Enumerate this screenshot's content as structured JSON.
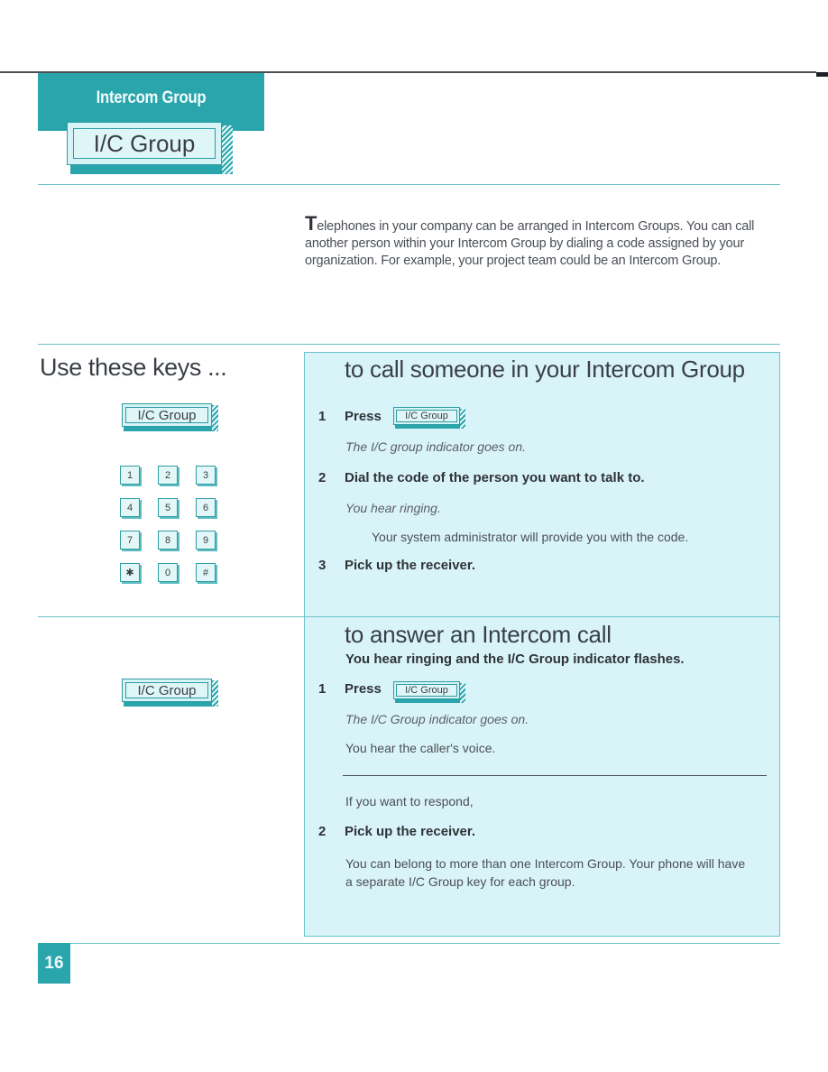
{
  "header": {
    "band_label": "Intercom Group",
    "key_label": "I/C Group"
  },
  "intro": {
    "drop_cap": "T",
    "text": "elephones in your company can be arranged in Intercom Groups. You can call another person within your Intercom Group by dialing a code assigned by your organization. For example, your project team could be an Intercom Group."
  },
  "left_column": {
    "heading": "Use these keys ...",
    "key_label": "I/C Group",
    "keypad": [
      "1",
      "2",
      "3",
      "4",
      "5",
      "6",
      "7",
      "8",
      "9",
      "✱",
      "0",
      "#"
    ],
    "answer_key_label": "I/C Group"
  },
  "call_section": {
    "title": "to call someone in your Intercom Group",
    "steps": [
      {
        "num": "1",
        "action": "Press",
        "key_label": "I/C Group",
        "result": "The I/C group indicator goes on."
      },
      {
        "num": "2",
        "action": "Dial the code of the person you want to talk to.",
        "result": "You hear ringing.",
        "note": "Your system administrator will provide you with the code."
      },
      {
        "num": "3",
        "action": "Pick up the receiver."
      }
    ]
  },
  "answer_section": {
    "title": "to answer an Intercom call",
    "subtitle": "You hear ringing and the I/C Group indicator flashes.",
    "steps": [
      {
        "num": "1",
        "action": "Press",
        "key_label": "I/C Group",
        "result": "The I/C Group indicator goes on.",
        "note": "You hear the caller's voice."
      },
      {
        "num": "2",
        "action": "Pick up the receiver.",
        "pre": "If you want to respond,",
        "note": "You can belong to more than one Intercom Group. Your phone will have a separate I/C Group key for each group."
      }
    ]
  },
  "footer": {
    "page_number": "16"
  },
  "colors": {
    "accent": "#2aa5ac",
    "panel": "#d9f4f8",
    "text": "#3a3f46"
  }
}
